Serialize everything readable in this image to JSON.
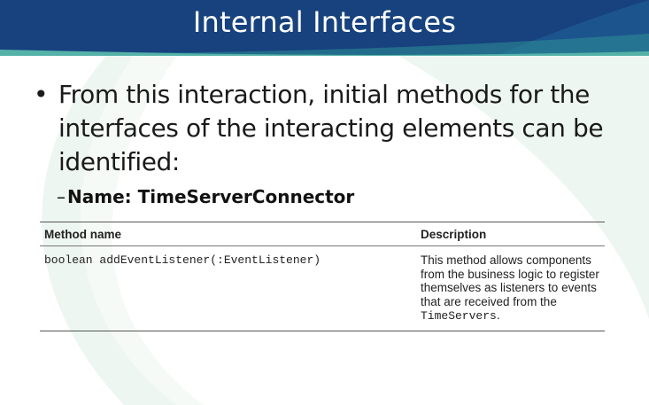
{
  "slide": {
    "title": "Internal Interfaces",
    "bullet_char": "•",
    "bullet_text": "From this interaction, initial methods for the interfaces of the interacting elements can be identified:",
    "sub_dash": "–",
    "sub_text": "Name: TimeServerConnector"
  },
  "table": {
    "headers": {
      "method": "Method name",
      "description": "Description"
    },
    "rows": [
      {
        "method": "boolean addEventListener(:EventListener)",
        "desc_text": "This method allows components from the business logic to register themselves as listeners to events that are received from the ",
        "desc_code": "TimeServers",
        "desc_end": "."
      }
    ]
  },
  "colors": {
    "title_bar": "#17427e",
    "title_text": "#ffffff",
    "decor_teal": "#2d8f97",
    "decor_light": "#eef6f1"
  }
}
